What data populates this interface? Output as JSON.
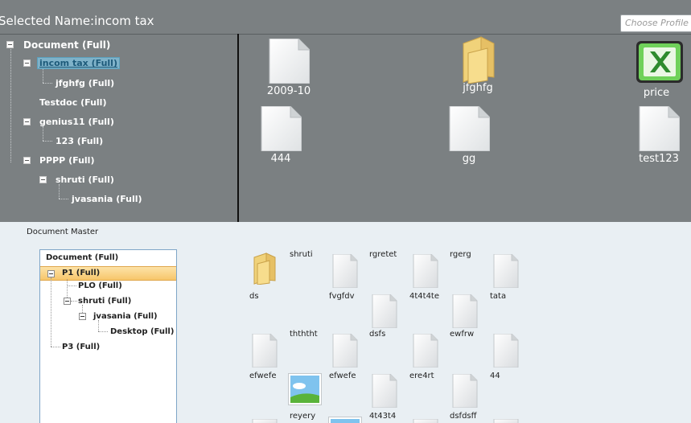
{
  "header": {
    "selected_name": "Selected Name:incom tax",
    "profile_placeholder": "Choose Profile N"
  },
  "top_tree": {
    "root": "Document (Full)",
    "items": [
      "incom tax (Full)",
      "jfghfg (Full)",
      "Testdoc (Full)",
      "genius11 (Full)",
      "123 (Full)",
      "PPPP (Full)",
      "shruti (Full)",
      "jvasania (Full)"
    ]
  },
  "top_files": [
    {
      "name": "2009-10",
      "icon": "document-icon"
    },
    {
      "name": "jfghfg",
      "icon": "folder-icon"
    },
    {
      "name": "price",
      "icon": "excel-icon"
    },
    {
      "name": "444",
      "icon": "document-icon"
    },
    {
      "name": "gg",
      "icon": "document-icon"
    },
    {
      "name": "test123",
      "icon": "document-icon"
    }
  ],
  "bottom": {
    "title": "Document Master",
    "tree": {
      "root": "Document (Full)",
      "items": [
        "P1 (Full)",
        "PLO (Full)",
        "shruti (Full)",
        "jvasania (Full)",
        "Desktop (Full)",
        "P3 (Full)"
      ]
    },
    "files": [
      "ds",
      "shruti",
      "rgretet",
      "rgerg",
      "fvgfdv",
      "4t4t4te",
      "tata",
      "thththt",
      "dsfs",
      "ewfrw",
      "efwefe",
      "efwefe",
      "ere4rt",
      "44",
      "reyery",
      "4t43t4",
      "dsfdsff"
    ]
  },
  "colors": {
    "top_background": "#7b8082",
    "bottom_background": "#e9eff3",
    "selection_blue": "#7fb2c9",
    "selection_orange": "#f7c66a",
    "excel_green": "#2e8b2e"
  }
}
